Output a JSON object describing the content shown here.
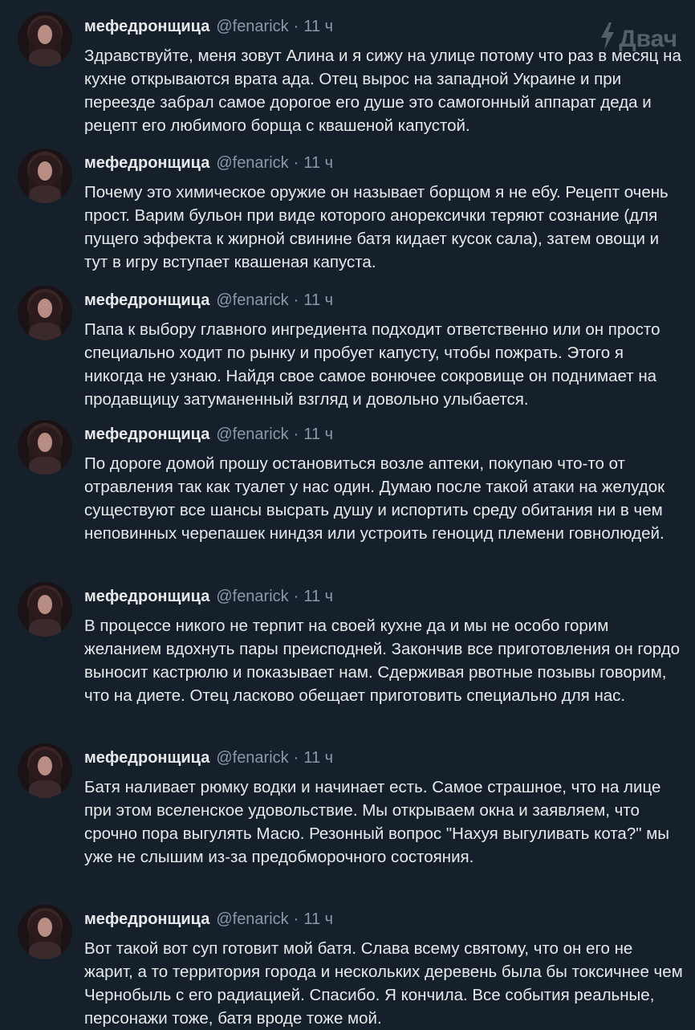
{
  "watermark": "Двач",
  "tweets": [
    {
      "name": "мефедронщица",
      "handle": "@fenarick",
      "separator": "·",
      "time": "11 ч",
      "text": "Здравствуйте, меня зовут Алина и я сижу на улице потому что раз в месяц на кухне открываются врата ада. Отец вырос на западной Украине и при переезде забрал самое дорогое его душе это самогонный аппарат деда и рецепт его любимого борща с квашеной капустой."
    },
    {
      "name": "мефедронщица",
      "handle": "@fenarick",
      "separator": "·",
      "time": "11 ч",
      "text": "Почему это химическое оружие он называет борщом я не ебу. Рецепт очень прост. Варим бульон при виде которого анорексички теряют сознание (для пущего эффекта к жирной свинине батя кидает кусок сала), затем овощи и тут в игру вступает квашеная капуста."
    },
    {
      "name": "мефедронщица",
      "handle": "@fenarick",
      "separator": "·",
      "time": "11 ч",
      "text": "Папа к выбору главного ингредиента подходит ответственно или он просто специально ходит по рынку и пробует капусту, чтобы пожрать. Этого я никогда не узнаю. Найдя свое самое вонючее сокровище он поднимает на продавщицу затуманенный взгляд и довольно улыбается."
    },
    {
      "name": "мефедронщица",
      "handle": "@fenarick",
      "separator": "·",
      "time": "11 ч",
      "text": "По дороге домой прошу остановиться возле аптеки, покупаю что-то от отравления так как туалет у нас один. Думаю после такой атаки на желудок существуют все шансы высрать душу и испортить среду обитания ни в чем неповинных черепашек ниндзя или устроить геноцид племени говнолюдей."
    },
    {
      "name": "мефедронщица",
      "handle": "@fenarick",
      "separator": "·",
      "time": "11 ч",
      "text": "В процессе никого не терпит на своей кухне да и мы не особо горим желанием вдохнуть пары преисподней. Закончив все приготовления он гордо выносит кастрюлю и показывает нам. Сдерживая рвотные позывы говорим, что на диете. Отец ласково обещает приготовить специально для нас."
    },
    {
      "name": "мефедронщица",
      "handle": "@fenarick",
      "separator": "·",
      "time": "11 ч",
      "text": "Батя наливает рюмку водки и начинает есть. Самое страшное, что на лице при этом вселенское удовольствие. Мы открываем окна и заявляем, что срочно пора выгулять Масю. Резонный вопрос \"Нахуя выгуливать кота?\" мы уже не слышим из-за предобморочного состояния."
    },
    {
      "name": "мефедронщица",
      "handle": "@fenarick",
      "separator": "·",
      "time": "11 ч",
      "text": "Вот такой вот суп готовит мой батя. Слава всему святому, что он его не жарит, а то территория города и нескольких деревень была бы токсичнее чем Чернобыль с его радиацией. Спасибо. Я кончила. Все события реальные, персонажи тоже, батя вроде тоже мой."
    }
  ]
}
